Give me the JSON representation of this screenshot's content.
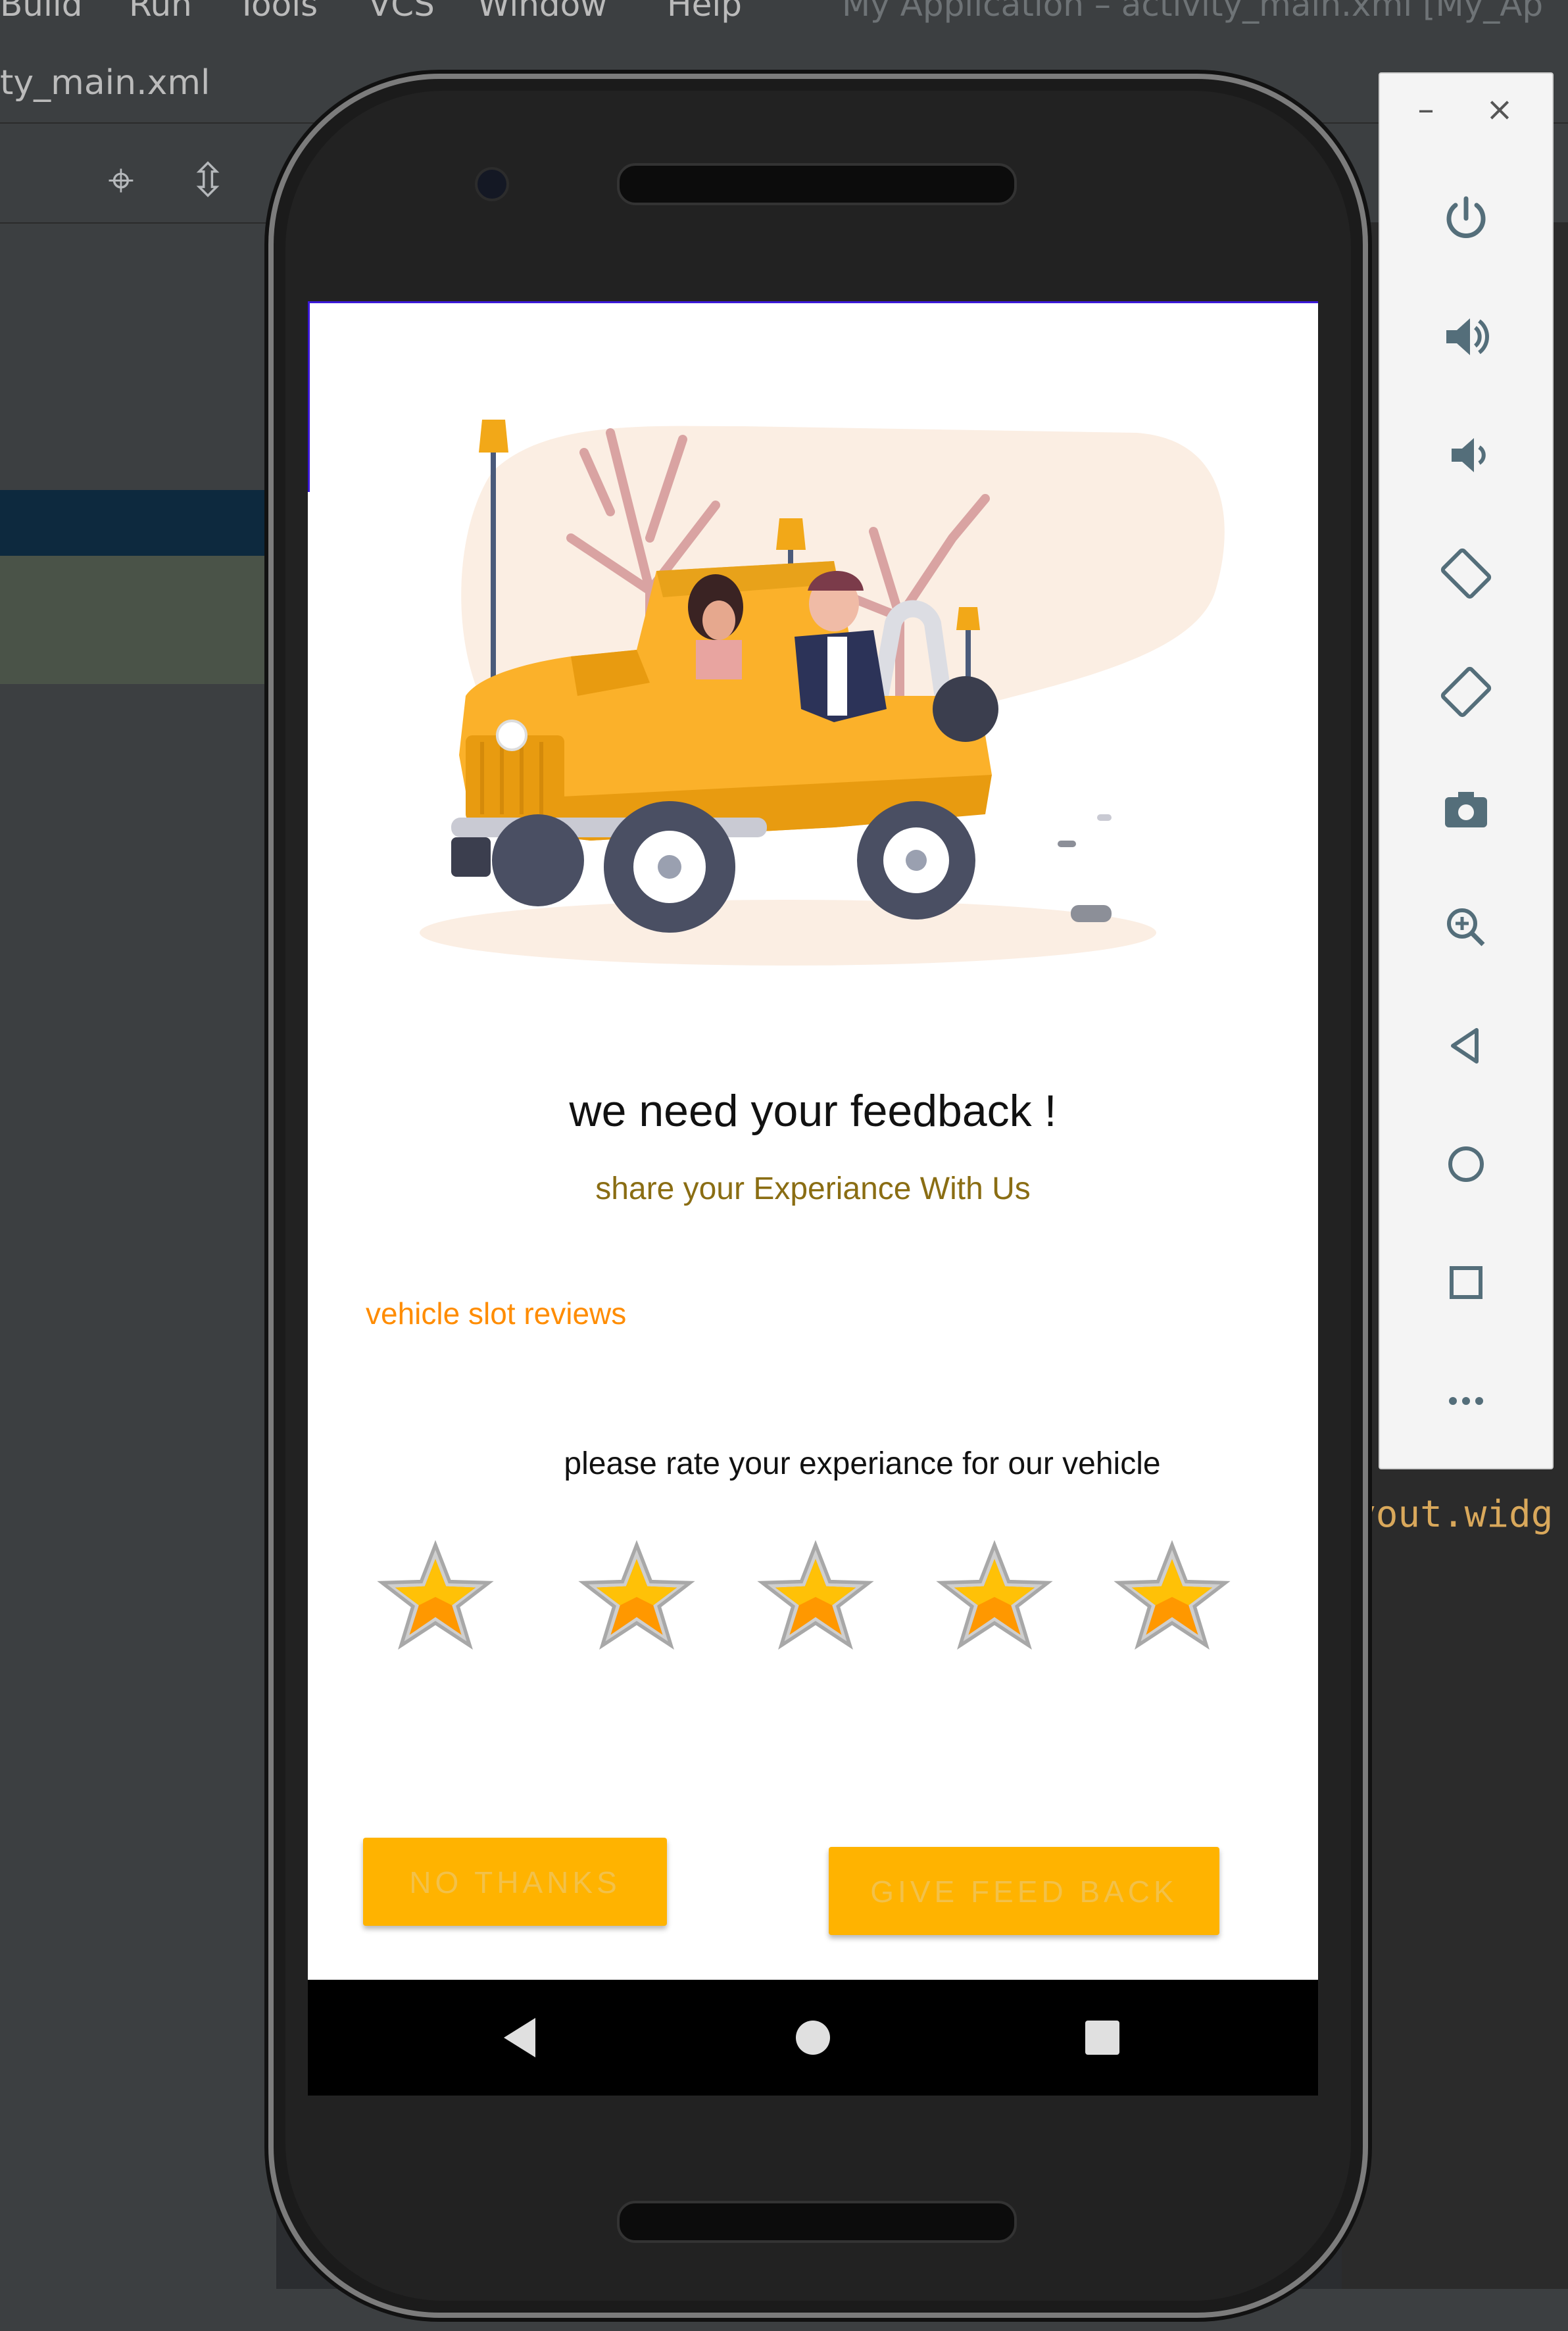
{
  "ide": {
    "menu": [
      "Build",
      "Run",
      "Tools",
      "VCS",
      "Window",
      "Help"
    ],
    "window_title": "My Application – activity_main.xml [My_Ap",
    "file_tab": "ty_main.xml",
    "code_fragment": "yout.widg"
  },
  "app": {
    "title": "we need your feedback !",
    "subtitle": "share your Experiance With Us",
    "section_label": "vehicle slot reviews",
    "rating_prompt": "please rate your experiance for our vehicle",
    "rating": {
      "value": 5,
      "max": 5
    },
    "buttons": {
      "no_thanks": "NO THANKS",
      "give_feedback": "GIVE FEED BACK"
    }
  },
  "navbar": {
    "icons": [
      "back-icon",
      "home-icon",
      "recents-icon"
    ]
  },
  "emulator_panel": {
    "window_controls": [
      "minimize",
      "close"
    ],
    "icons": [
      "power-icon",
      "volume-up-icon",
      "volume-down-icon",
      "rotate-left-icon",
      "rotate-right-icon",
      "camera-icon",
      "zoom-icon",
      "back-icon",
      "home-icon",
      "overview-icon",
      "more-icon"
    ]
  },
  "colors": {
    "accent": "#ffb300",
    "section_label": "#ff8c00",
    "subtitle": "#8a6d13",
    "ide_bg": "#2b2d30"
  }
}
